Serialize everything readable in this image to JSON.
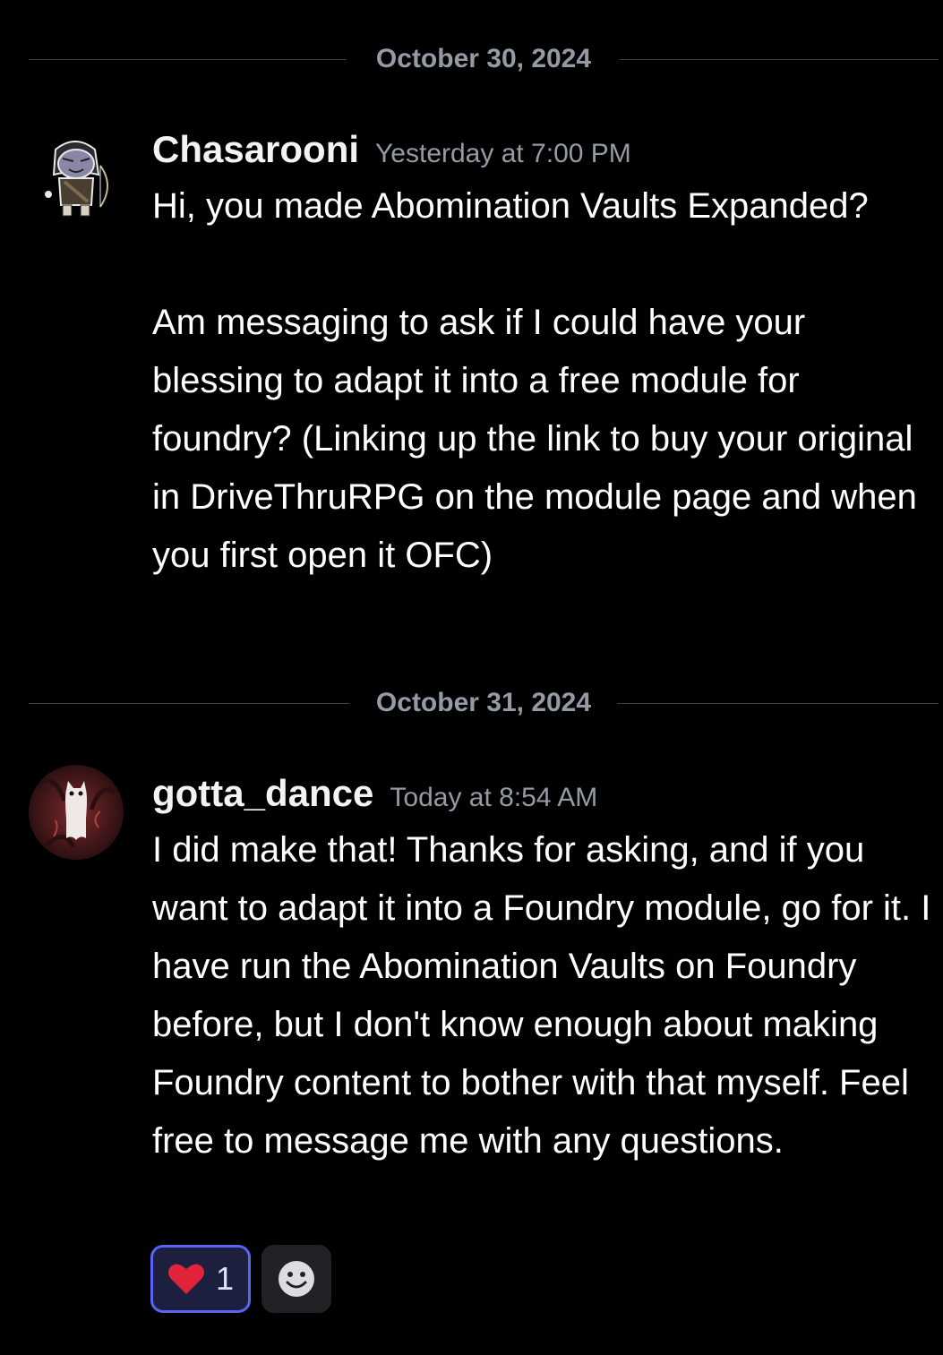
{
  "dividers": [
    {
      "date": "October 30, 2024"
    },
    {
      "date": "October 31, 2024"
    }
  ],
  "messages": [
    {
      "username": "Chasarooni",
      "timestamp": "Yesterday at 7:00 PM",
      "paragraphs": [
        "Hi, you made Abomination Vaults Expanded?",
        "Am messaging to ask if I could have your blessing to adapt it into a free module for foundry? (Linking up the link to buy your original in DriveThruRPG on the module page and when you first open it OFC)"
      ],
      "avatar_icon": "archer-character-avatar"
    },
    {
      "username": "gotta_dance",
      "timestamp": "Today at 8:54 AM",
      "paragraphs": [
        "I did make that! Thanks for asking, and if you want to adapt it into a Foundry module, go for it. I have run the Abomination Vaults on Foundry before, but I don't know enough about making Foundry content to bother with that myself. Feel free to message me with any questions."
      ],
      "avatar_icon": "ghost-forest-avatar"
    }
  ],
  "reactions": {
    "heart": {
      "emoji": "heart-icon",
      "count": "1"
    },
    "add": {
      "icon": "add-reaction-smiley-icon"
    }
  },
  "colors": {
    "background": "#000000",
    "divider_text": "#949ba4",
    "reaction_border": "#5865f2",
    "heart": "#e0243b"
  }
}
